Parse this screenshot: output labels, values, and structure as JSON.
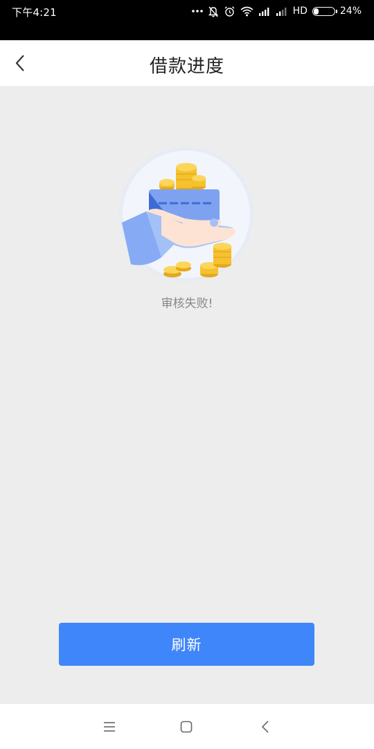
{
  "status_bar": {
    "time": "下午4:21",
    "network": "HD",
    "battery_percent": "24%",
    "battery_level": 0.24
  },
  "header": {
    "title": "借款进度",
    "back_icon": "chevron-left-icon"
  },
  "main": {
    "illustration_icon": "hand-card-coins-illustration",
    "status_message": "审核失败!",
    "refresh_label": "刷新"
  },
  "system_nav": {
    "menu_icon": "menu-icon",
    "home_icon": "home-icon",
    "back_icon": "back-icon"
  },
  "colors": {
    "primary": "#3f86fb",
    "background": "#ededed",
    "coin": "#f5c12e"
  }
}
